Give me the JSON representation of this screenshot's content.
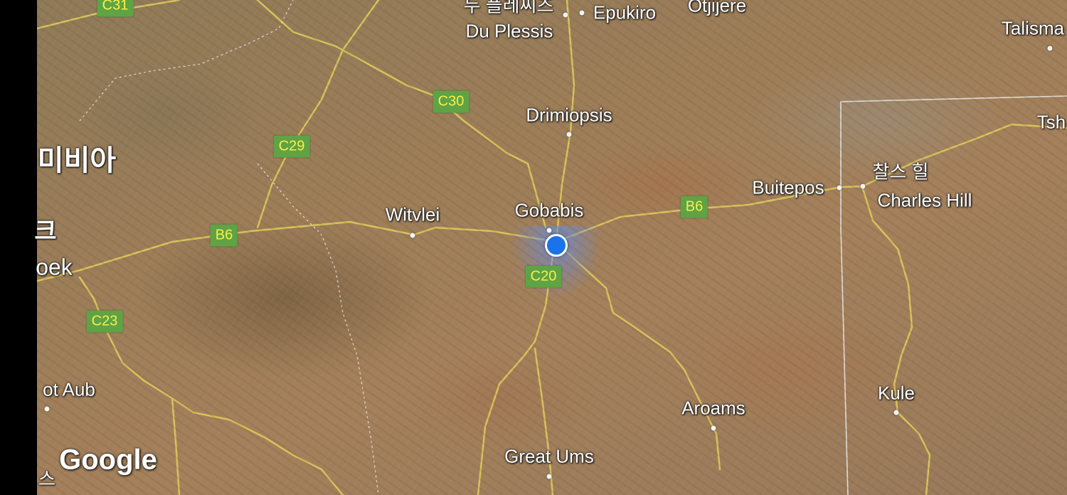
{
  "map": {
    "places": {
      "du_plessis_ko": "두 플레씨즈",
      "du_plessis": "Du Plessis",
      "epukiro": "Epukiro",
      "otjijere": "Otjijere",
      "talismanis": "Talisma",
      "drimiopsis": "Drimiopsis",
      "namibia_ko": "미비아",
      "windhoek_ko": "크",
      "windhoek": "oek",
      "witvlei": "Witvlei",
      "gobabis": "Gobabis",
      "buitepos": "Buitepos",
      "charles_hill_ko": "찰스 힐",
      "charles_hill": "Charles Hill",
      "tsh": "Tsh",
      "dordabis": "ot Aub",
      "kule": "Kule",
      "aroams": "Aroams",
      "great_ums": "Great Ums",
      "bottom_left_ko": "스"
    },
    "road_shields": {
      "c31": "C31",
      "c30": "C30",
      "c29": "C29",
      "b6_west": "B6",
      "b6_east": "B6",
      "c20": "C20",
      "c23": "C23"
    },
    "attribution": "Google"
  }
}
